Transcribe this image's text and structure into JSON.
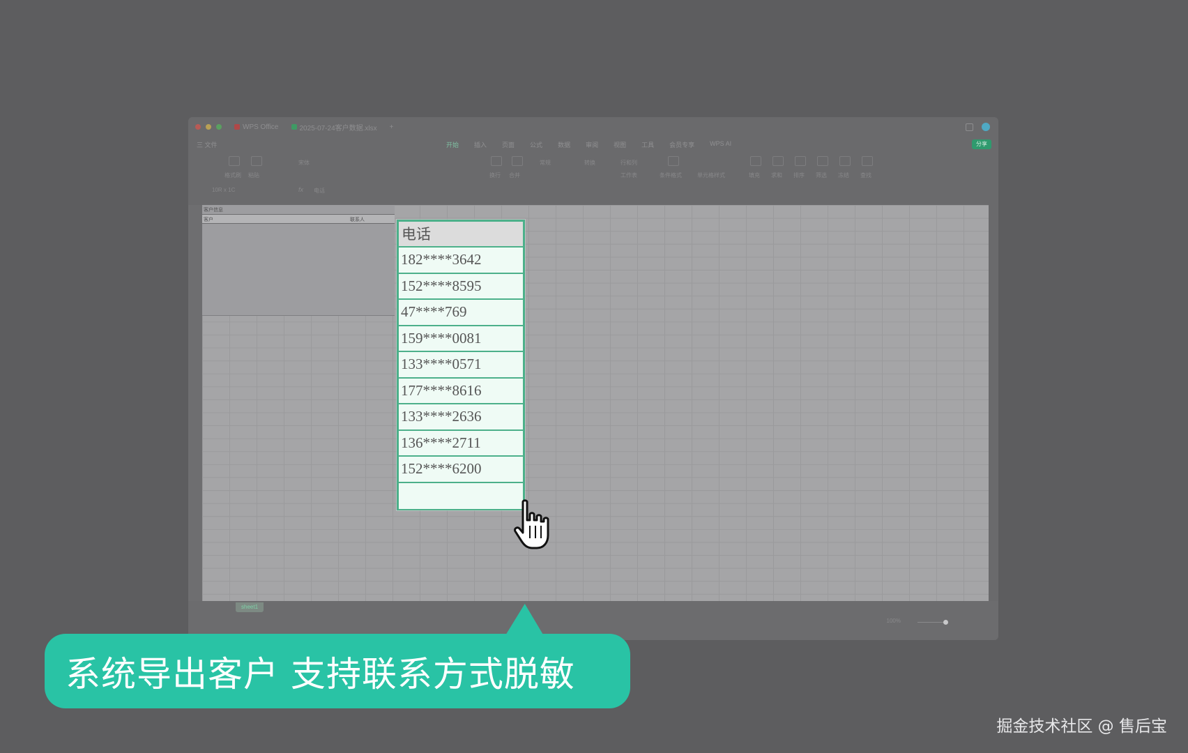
{
  "window": {
    "app_name": "WPS Office",
    "file_tab": "2025-07-24客户数据.xlsx",
    "menu": {
      "file": "三 文件",
      "items": [
        "开始",
        "插入",
        "页面",
        "公式",
        "数据",
        "审阅",
        "视图",
        "工具",
        "会员专享",
        "WPS AI"
      ],
      "active": "开始",
      "share": "分享"
    },
    "ribbon_labels": [
      "格式刷",
      "粘贴",
      "宋体",
      "换行",
      "合并",
      "常规",
      "转换",
      "行和列",
      "工作表",
      "条件格式",
      "单元格样式",
      "填充",
      "求和",
      "排序",
      "筛选",
      "冻结",
      "查找"
    ],
    "formula_bar": {
      "name_box": "10R x 1C",
      "fx": "fx",
      "content": "电话"
    },
    "table": {
      "title": "客户信息",
      "headers": [
        "客户",
        "联系人"
      ]
    },
    "sheet_tab": "sheet1",
    "zoom": "100%"
  },
  "phone_column": {
    "header": "电话",
    "values": [
      "182****3642",
      "152****8595",
      "47****769",
      "159****0081",
      "133****0571",
      "177****8616",
      "133****2636",
      "136****2711",
      "152****6200"
    ]
  },
  "caption": "系统导出客户 支持联系方式脱敏",
  "watermark": "掘金技术社区 @ 售后宝",
  "colors": {
    "background": "#5d5d5f",
    "accent": "#29c3a5",
    "highlight_border": "#4cb08a"
  }
}
